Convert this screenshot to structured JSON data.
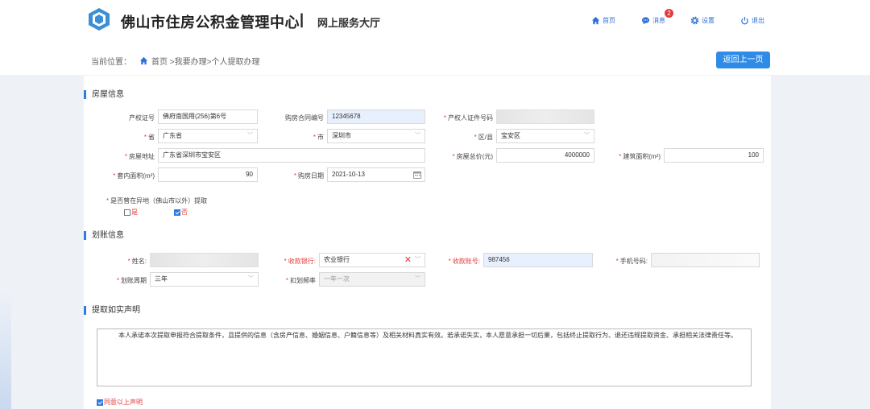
{
  "header": {
    "site_title": "佛山市住房公积金管理中心",
    "separator": "|",
    "site_subtitle": "网上服务大厅",
    "nav": [
      {
        "label": "首页",
        "icon": "home-icon"
      },
      {
        "label": "消息",
        "icon": "message-icon"
      },
      {
        "label": "设置",
        "icon": "gear-icon"
      },
      {
        "label": "退出",
        "icon": "power-icon"
      }
    ],
    "message_badge": "2"
  },
  "breadcrumb": {
    "prefix": "当前位置：",
    "path": "首页 >我要办理>个人提取办理"
  },
  "back_button": "返回上一页",
  "house_section": {
    "title": "房屋信息",
    "property_cert": {
      "label": "产权证号",
      "value": "佛府南国用(256)第6号"
    },
    "contract_no": {
      "label": "购房合同编号",
      "value": "12345678"
    },
    "owner_id": {
      "label": "产权人证件号码",
      "value": ""
    },
    "province": {
      "label": "省",
      "value": "广东省"
    },
    "city": {
      "label": "市",
      "value": "深圳市"
    },
    "district": {
      "label": "区/县",
      "value": "宝安区"
    },
    "address": {
      "label": "房屋地址",
      "value": "广东省深圳市宝安区"
    },
    "total_price": {
      "label": "房屋总价(元)",
      "value": "4000000"
    },
    "build_area": {
      "label": "建筑面积(m²)",
      "value": "100"
    },
    "inner_area": {
      "label": "套内面积(m²)",
      "value": "90"
    },
    "buy_date": {
      "label": "购房日期",
      "value": "2021-10-13"
    },
    "offsite": {
      "label": "是否曾在异地（佛山市以外）提取",
      "yes": "是",
      "no": "否",
      "selected": "否"
    }
  },
  "transfer_section": {
    "title": "划账信息",
    "name": {
      "label": "姓名:",
      "value": ""
    },
    "bank": {
      "label": "收款银行:",
      "value": "农业银行"
    },
    "account": {
      "label": "收款账号:",
      "value": "987456"
    },
    "phone": {
      "label": "手机号码:",
      "value": ""
    },
    "cycle": {
      "label": "划账周期",
      "value": "三年"
    },
    "frequency": {
      "label": "扣划频率",
      "value": "一年一次"
    }
  },
  "declaration_section": {
    "title": "提取如实声明",
    "text": "本人承诺本次提取申报符合提取条件，且提供的信息（含房产信息、婚姻信息、户籍信息等）及相关材料真实有效。若承诺失实，本人愿意承担一切后果，包括终止提取行为、退还违规提取资金、承担相关法律责任等。",
    "agree_label": "同意以上声明",
    "agreed": true
  },
  "colors": {
    "accent": "#2f7be0",
    "button": "#2f8be8",
    "required": "#e23c3c"
  }
}
